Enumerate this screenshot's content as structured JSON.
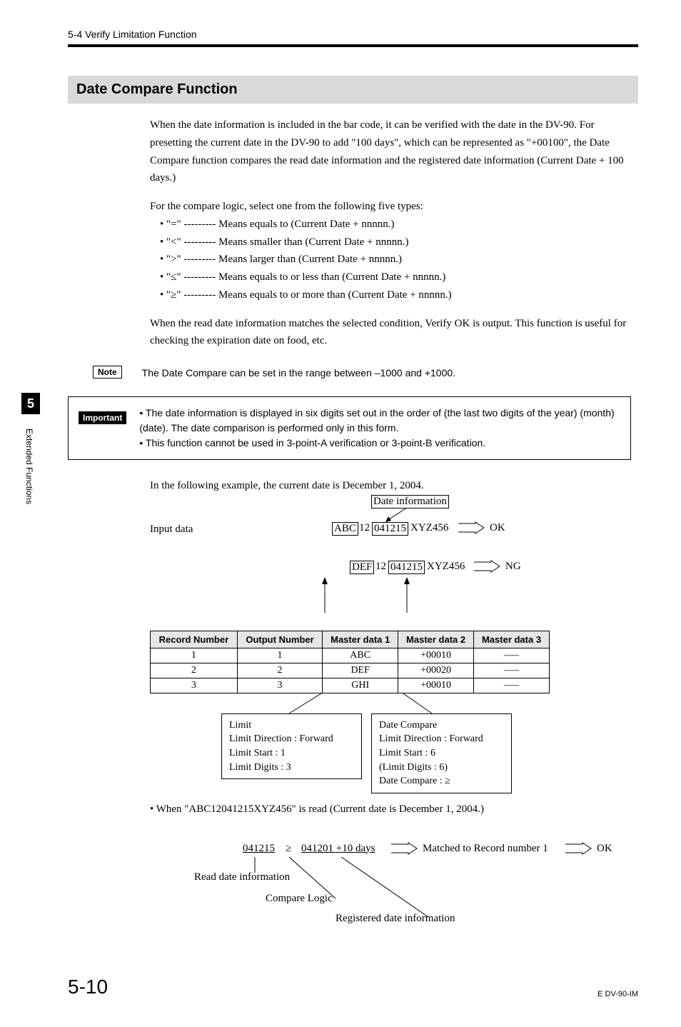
{
  "header": "5-4  Verify Limitation Function",
  "section_title": "Date Compare Function",
  "intro_p1": "When the date information is included in the bar code, it can be verified with the date in the DV-90. For presetting the current date in the DV-90 to add \"100 days\", which can be represented as \"+00100\", the Date Compare function compares the read date information and the registered date information (Current Date + 100 days.)",
  "intro_p2": "For the compare logic, select one from the following five types:",
  "logic_items": [
    "\"=\" --------- Means equals to (Current Date + nnnnn.)",
    "\"<\" --------- Means smaller than (Current Date + nnnnn.)",
    "\">\" --------- Means larger than (Current Date + nnnnn.)",
    "\"≤\" --------- Means equals to or less than (Current Date + nnnnn.)",
    "\"≥\" --------- Means equals to or more than (Current Date + nnnnn.)"
  ],
  "intro_p3": "When the read date information matches the selected condition, Verify OK is output. This function is useful for checking the expiration date on food, etc.",
  "note_label": "Note",
  "note_text": "The Date Compare can be set in the range between –1000 and +1000.",
  "important_label": "Important",
  "important_items": [
    "The date information is displayed in six digits set out in the order of (the last two digits of the year) (month) (date). The date comparison is performed only in this form.",
    "This function cannot be used in 3-point-A verification or 3-point-B verification."
  ],
  "example_intro": "In the following example, the current date is December 1, 2004.",
  "diagram": {
    "input_label": "Input data",
    "date_info_label": "Date information",
    "row1": {
      "p1": "ABC",
      "p2": "12",
      "date": "041215",
      "p3": "XYZ456",
      "result": "OK"
    },
    "row2": {
      "p1": "DEF",
      "p2": "12",
      "date": "041215",
      "p3": "XYZ456",
      "result": "NG"
    }
  },
  "table": {
    "headers": [
      "Record Number",
      "Output Number",
      "Master data 1",
      "Master data 2",
      "Master data 3"
    ],
    "rows": [
      [
        "1",
        "1",
        "ABC",
        "+00010",
        "—–"
      ],
      [
        "2",
        "2",
        "DEF",
        "+00020",
        "—–"
      ],
      [
        "3",
        "3",
        "GHI",
        "+00010",
        "—–"
      ]
    ]
  },
  "limit_box": {
    "l1": "Limit",
    "l2": "Limit Direction : Forward",
    "l3": "Limit Start        : 1",
    "l4": "Limit Digits      : 3"
  },
  "datecmp_box": {
    "l1": "Date Compare",
    "l2": "Limit Direction : Forward",
    "l3": "Limit Start        : 6",
    "l4": "(Limit Digits     : 6)",
    "l5": "Date Compare  : ≥"
  },
  "when_read": "When \"ABC12041215XYZ456\" is read (Current date is December 1, 2004.)",
  "explain": {
    "read": "041215",
    "op": "≥",
    "reg": "041201 +10 days",
    "matched": "Matched to Record number 1",
    "ok": "OK",
    "read_label": "Read date information",
    "cmp_label": "Compare Logic",
    "reg_label": "Registered date information"
  },
  "side": {
    "chapter": "5",
    "label": "Extended Functions"
  },
  "footer": {
    "page": "5-10",
    "doc": "E DV-90-IM"
  }
}
